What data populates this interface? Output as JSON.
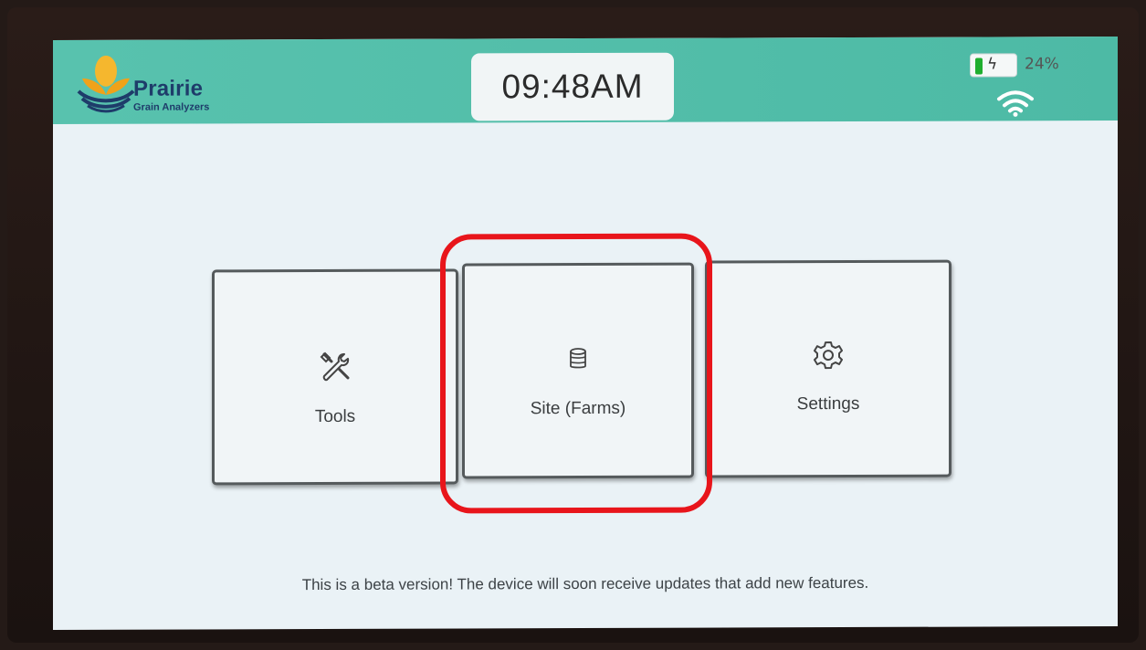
{
  "header": {
    "brand_name": "Prairie",
    "brand_tagline": "Grain Analyzers",
    "clock": "09:48AM",
    "battery_percent": "24%",
    "battery_level": 0.24,
    "battery_charging": true,
    "wifi_icon": "wifi-icon"
  },
  "menu": {
    "tiles": [
      {
        "label": "Tools",
        "icon": "tools-icon"
      },
      {
        "label": "Site (Farms)",
        "icon": "database-icon"
      },
      {
        "label": "Settings",
        "icon": "gear-icon"
      }
    ],
    "highlighted_tile": "Site (Farms)"
  },
  "footer": {
    "notice": "This is a beta version!  The device will soon receive updates that add new features."
  },
  "colors": {
    "header_teal": "#58c2ae",
    "brand_navy": "#1e3c6a",
    "highlight_red": "#e8151b",
    "battery_green": "#1fae2e"
  }
}
